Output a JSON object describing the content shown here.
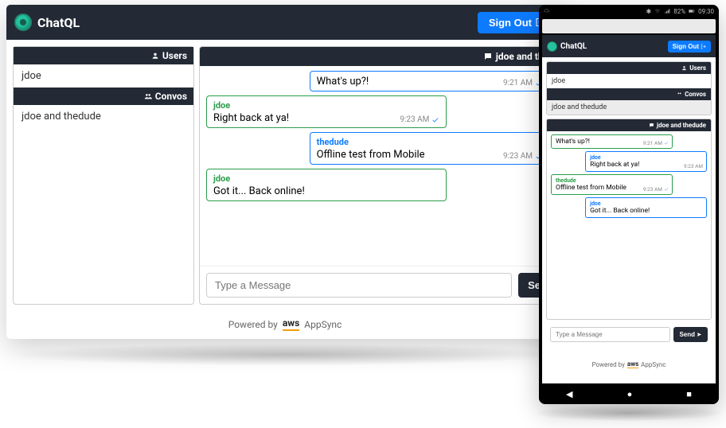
{
  "brand": {
    "name": "ChatQL"
  },
  "signout_label": "Sign Out",
  "sidebar": {
    "users_header": "Users",
    "users": [
      "jdoe"
    ],
    "convos_header": "Convos",
    "convos": [
      "jdoe and thedude"
    ]
  },
  "chat": {
    "title_prefix": "jdoe and the",
    "messages": [
      {
        "sender": null,
        "body": "What's up?!",
        "time": "9:21 AM",
        "side": "in",
        "check": true
      },
      {
        "sender": "jdoe",
        "body": "Right back at ya!",
        "time": "9:23 AM",
        "side": "out",
        "check": true
      },
      {
        "sender": "thedude",
        "body": "Offline test from Mobile",
        "time": "9:23 AM",
        "side": "in",
        "check": true
      },
      {
        "sender": "jdoe",
        "body": "Got it... Back online!",
        "time": "",
        "side": "out",
        "check": false
      }
    ],
    "placeholder": "Type a Message",
    "send_label": "Se"
  },
  "footer": {
    "pre": "Powered by",
    "brand": "aws",
    "suffix": "AppSync"
  },
  "mobile": {
    "status": {
      "bt": "✱",
      "battery_pct": "82%",
      "clock": "09:30"
    },
    "chat_title": "jdoe and thedude",
    "messages": [
      {
        "sender": null,
        "body": "What's up?!",
        "time": "9:21 AM",
        "side": "in",
        "check": true
      },
      {
        "sender": "jdoe",
        "body": "Right back at ya!",
        "time": "9:23 AM",
        "side": "out",
        "check": false
      },
      {
        "sender": "thedude",
        "body": "Offline test from Mobile",
        "time": "9:23 AM",
        "side": "in",
        "check": true
      },
      {
        "sender": "jdoe",
        "body": "Got it... Back online!",
        "time": "",
        "side": "out",
        "check": false
      }
    ],
    "send_label": "Send"
  }
}
